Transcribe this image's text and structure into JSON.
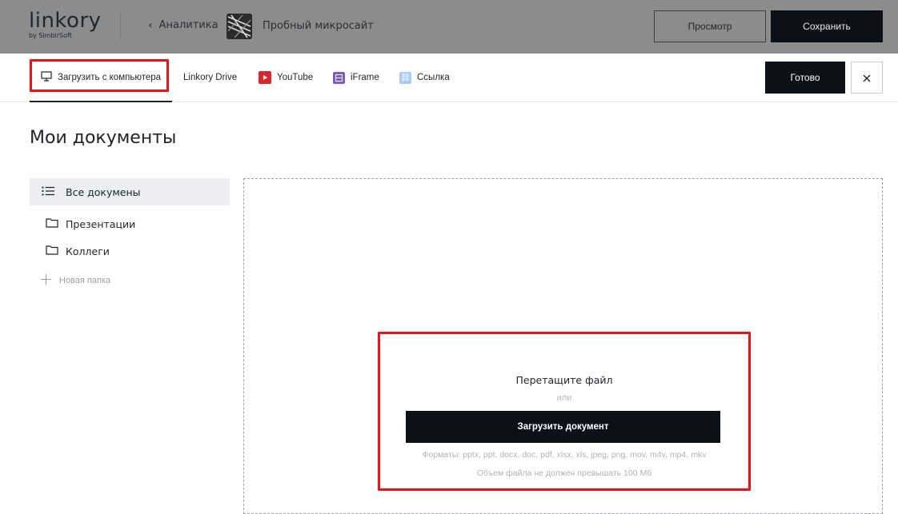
{
  "header": {
    "logo_text": "linkory",
    "logo_sub": "by SimbirSoft",
    "back_label": "Аналитика",
    "site_name": "Пробный микросайт",
    "preview_label": "Просмотр",
    "save_label": "Сохранить"
  },
  "tabs": {
    "upload": "Загрузить с компьютера",
    "drive": "Linkory Drive",
    "youtube": "YouTube",
    "iframe": "iFrame",
    "link": "Ссылка",
    "done_label": "Готово"
  },
  "main": {
    "title": "Мои документы"
  },
  "sidebar": {
    "all_label": "Все докумены",
    "folders": [
      {
        "label": "Презентации"
      },
      {
        "label": "Коллеги"
      }
    ],
    "new_folder": "Новая папка"
  },
  "dropzone": {
    "title": "Перетащите файл",
    "or": "или",
    "upload_button": "Загрузить документ",
    "formats": "Форматы: pptx, ppt, docx, doc, pdf, xlsx, xls, jpeg, png, mov, m4v, mp4, mkv",
    "size_limit": "Объем файла не должен превышать 100 Мб"
  },
  "colors": {
    "header_bg": "#8c8c8c",
    "primary_dark": "#0c1117",
    "highlight_red": "#e8141b",
    "sidebar_active_bg": "#eceef1"
  },
  "icons": {
    "upload_tab": "monitor-icon",
    "youtube": "youtube-icon",
    "iframe": "iframe-icon",
    "link": "link-icon",
    "close": "close-icon",
    "list": "list-icon",
    "folder": "folder-icon",
    "add": "plus-icon"
  }
}
